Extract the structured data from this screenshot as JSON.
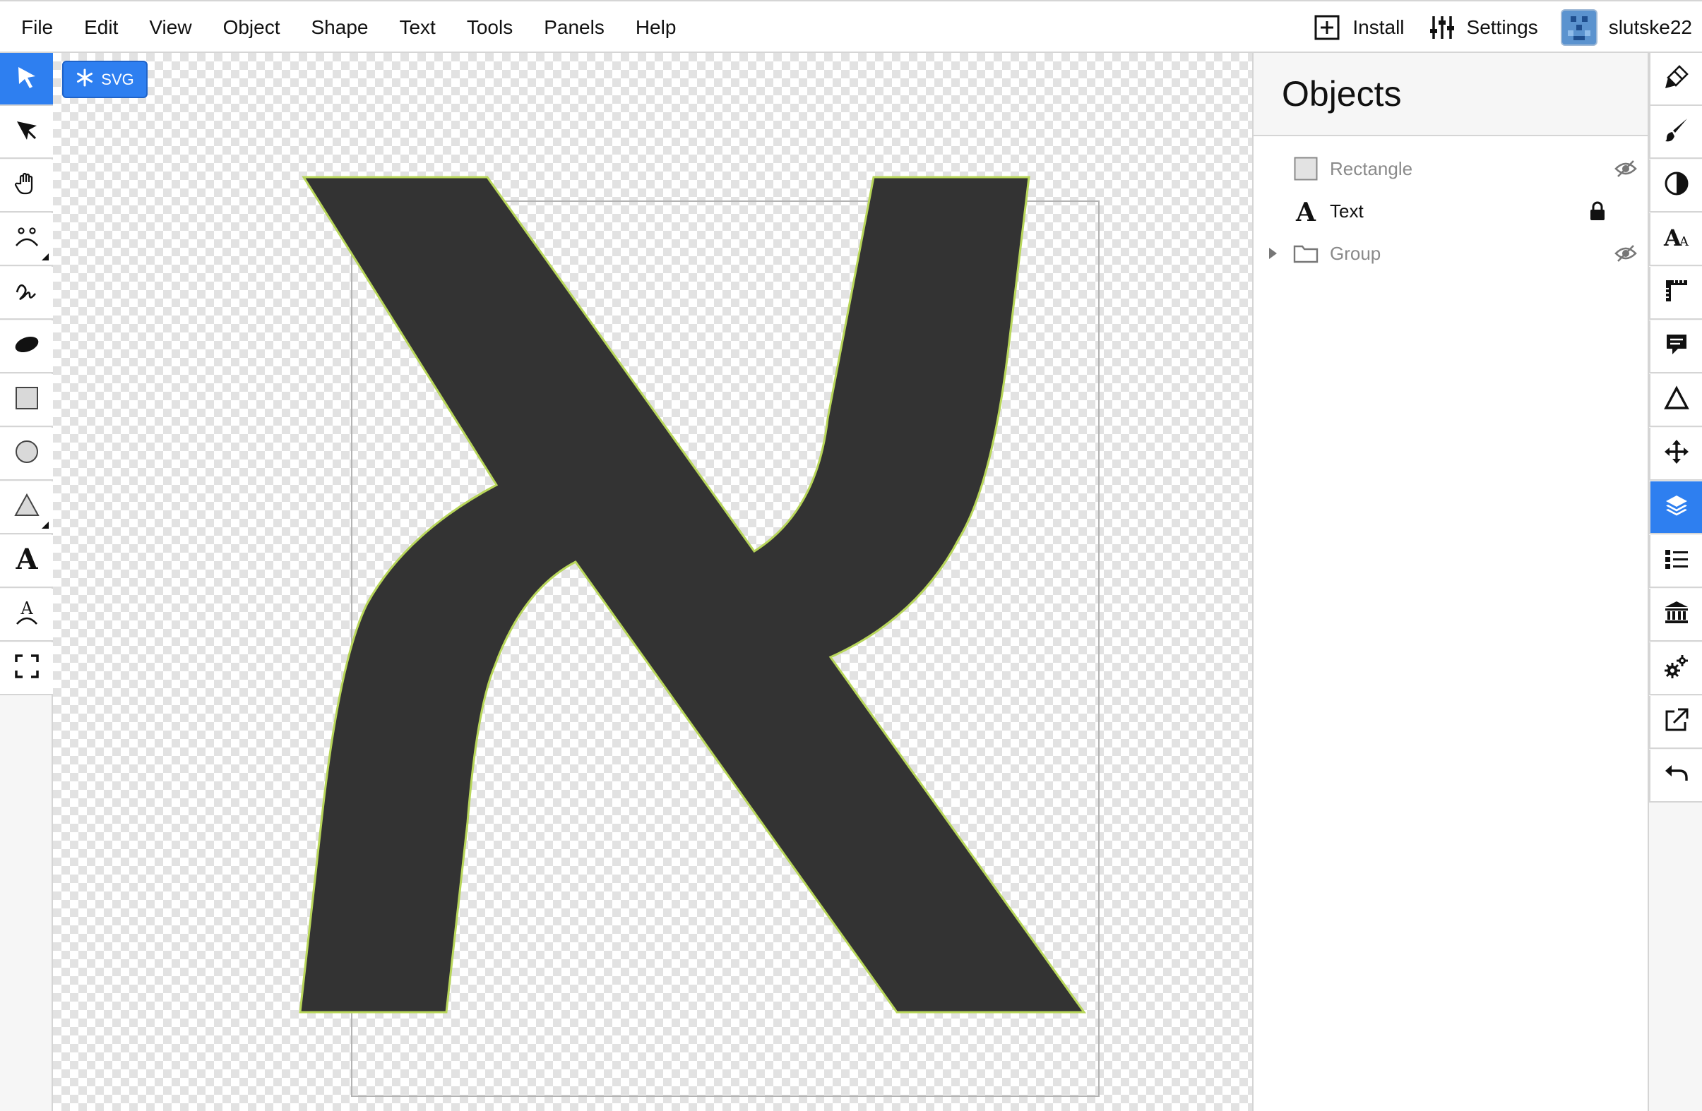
{
  "menu": {
    "items": [
      "File",
      "Edit",
      "View",
      "Object",
      "Shape",
      "Text",
      "Tools",
      "Panels",
      "Help"
    ],
    "install_label": "Install",
    "settings_label": "Settings",
    "username": "slutske22"
  },
  "canvas": {
    "badge_label": "SVG",
    "shape_fill": "#333333",
    "shape_stroke": "#b8d65a"
  },
  "objects_panel": {
    "title": "Objects",
    "items": [
      {
        "label": "Rectangle",
        "icon": "rectangle-icon",
        "state": "hidden"
      },
      {
        "label": "Text",
        "icon": "text-icon",
        "state": "locked"
      },
      {
        "label": "Group",
        "icon": "folder-icon",
        "state": "hidden"
      }
    ]
  },
  "left_tools": [
    "select-tool",
    "node-select-tool",
    "hand-tool",
    "face-tool",
    "freehand-tool",
    "ellipse-brush-tool",
    "rectangle-tool",
    "circle-tool",
    "triangle-tool",
    "text-tool",
    "text-on-path-tool",
    "fullscreen-tool"
  ],
  "right_tools": [
    "paint-tool",
    "brush-tool",
    "contrast-tool",
    "font-tool",
    "ruler-tool",
    "comment-tool",
    "delta-tool",
    "move-tool",
    "layers-tool",
    "list-tool",
    "library-tool",
    "plugins-tool",
    "export-tool",
    "undo-tool"
  ],
  "colors": {
    "accent": "#2e7ff0",
    "border": "#d5d5d5"
  }
}
